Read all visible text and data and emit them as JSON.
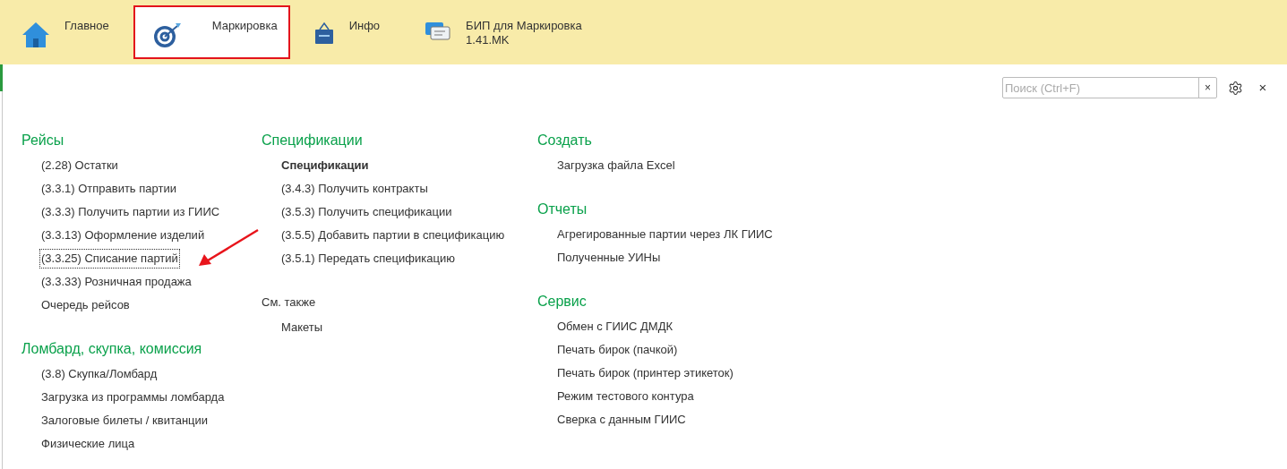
{
  "tabs": [
    {
      "label": "Главное",
      "selected": false
    },
    {
      "label": "Маркировка",
      "selected": true
    },
    {
      "label": "Инфо",
      "selected": false
    },
    {
      "label": "БИП для Маркировка",
      "sublabel": "1.41.MK",
      "selected": false
    }
  ],
  "search": {
    "placeholder": "Поиск (Ctrl+F)",
    "clear": "×"
  },
  "close": "×",
  "columns": [
    [
      {
        "kind": "section",
        "title": "Рейсы",
        "items": [
          {
            "text": "(2.28) Остатки",
            "bold": false,
            "focused": false
          },
          {
            "text": "(3.3.1) Отправить партии",
            "bold": false,
            "focused": false
          },
          {
            "text": "(3.3.3) Получить партии из ГИИС",
            "bold": false,
            "focused": false
          },
          {
            "text": "(3.3.13) Оформление изделий",
            "bold": false,
            "focused": false
          },
          {
            "text": "(3.3.25) Списание партий",
            "bold": false,
            "focused": true
          },
          {
            "text": "(3.3.33) Розничная продажа",
            "bold": false,
            "focused": false
          },
          {
            "text": "Очередь рейсов",
            "bold": false,
            "focused": false
          }
        ]
      },
      {
        "kind": "section",
        "title": "Ломбард, скупка, комиссия",
        "items": [
          {
            "text": "(3.8) Скупка/Ломбард",
            "bold": false,
            "focused": false
          },
          {
            "text": "Загрузка из программы ломбарда",
            "bold": false,
            "focused": false
          },
          {
            "text": "Залоговые билеты / квитанции",
            "bold": false,
            "focused": false
          },
          {
            "text": "Физические лица",
            "bold": false,
            "focused": false
          }
        ]
      }
    ],
    [
      {
        "kind": "section",
        "title": "Спецификации",
        "items": [
          {
            "text": "Спецификации",
            "bold": true,
            "focused": false
          },
          {
            "text": "(3.4.3) Получить контракты",
            "bold": false,
            "focused": false
          },
          {
            "text": "(3.5.3) Получить спецификации",
            "bold": false,
            "focused": false
          },
          {
            "text": "(3.5.5) Добавить партии в спецификацию",
            "bold": false,
            "focused": false
          },
          {
            "text": "(3.5.1) Передать спецификацию",
            "bold": false,
            "focused": false
          }
        ]
      },
      {
        "kind": "see_also",
        "title": "См. также",
        "items": [
          {
            "text": "Макеты",
            "bold": false,
            "focused": false
          }
        ]
      }
    ],
    [
      {
        "kind": "section",
        "title": "Создать",
        "items": [
          {
            "text": "Загрузка файла Excel",
            "bold": false,
            "focused": false
          }
        ]
      },
      {
        "kind": "section",
        "title": "Отчеты",
        "items": [
          {
            "text": "Агрегированные партии через ЛК ГИИС",
            "bold": false,
            "focused": false
          },
          {
            "text": "Полученные УИНы",
            "bold": false,
            "focused": false
          }
        ]
      },
      {
        "kind": "section",
        "title": "Сервис",
        "items": [
          {
            "text": "Обмен с ГИИС ДМДК",
            "bold": false,
            "focused": false
          },
          {
            "text": "Печать бирок (пачкой)",
            "bold": false,
            "focused": false
          },
          {
            "text": "Печать бирок (принтер этикеток)",
            "bold": false,
            "focused": false
          },
          {
            "text": "Режим тестового контура",
            "bold": false,
            "focused": false
          },
          {
            "text": "Сверка с данным ГИИС",
            "bold": false,
            "focused": false
          }
        ]
      }
    ]
  ]
}
